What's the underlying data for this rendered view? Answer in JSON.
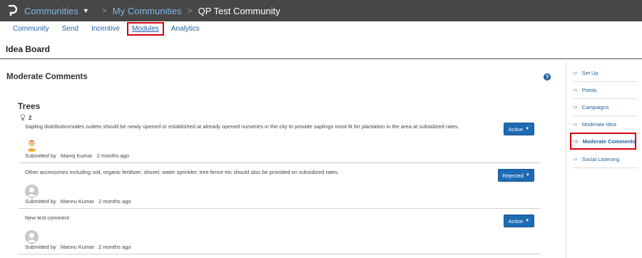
{
  "header": {
    "communities_label": "Communities",
    "my_communities_label": "My Communities",
    "current_community": "QP Test Community",
    "separator": ">"
  },
  "tabs": [
    {
      "label": "Community"
    },
    {
      "label": "Send"
    },
    {
      "label": "Incentive"
    },
    {
      "label": "Modules",
      "active": true
    },
    {
      "label": "Analytics"
    }
  ],
  "section_title": "Idea Board",
  "panel": {
    "title": "Moderate Comments",
    "help_glyph": "?"
  },
  "idea": {
    "title": "Trees",
    "comment_count": "2"
  },
  "comments": [
    {
      "text": "Sapling distribution/sales outlets should be newly opened or established at already opened nurseries in the city to provide saplings most-fit for plantation in the area at subsidized rates.",
      "submitted_by_label": "Submitted by",
      "author": "Manoj Kumar",
      "time": "2 months ago",
      "status": "Active",
      "avatar": "custom-avatar"
    },
    {
      "text": "Other accessories including soil, organic fertilizer, shovel, water sprinkler, tree fence etc should also be provided on subsidized rates.",
      "submitted_by_label": "Submitted by",
      "author": "Mannu Kumar",
      "time": "2 months ago",
      "status": "Rejected",
      "avatar": "default-avatar"
    },
    {
      "text": "New test comment",
      "submitted_by_label": "Submitted by",
      "author": "Mannu Kumar",
      "time": "2 months ago",
      "status": "Active",
      "avatar": "default-avatar"
    }
  ],
  "sidebar": {
    "items": [
      {
        "label": "Set Up",
        "icon": "sign-in-icon"
      },
      {
        "label": "Points",
        "icon": "sign-in-icon"
      },
      {
        "label": "Campaigns",
        "icon": "sign-in-icon"
      },
      {
        "label": "Moderate Idea",
        "icon": "sign-in-icon"
      },
      {
        "label": "Moderate Comments",
        "icon": "sign-in-icon",
        "active": true
      },
      {
        "label": "Social Listening",
        "icon": "sign-in-icon"
      }
    ]
  },
  "colors": {
    "topbar": "#474747",
    "link": "#1f5f9c",
    "button": "#1e6bb3",
    "highlight": "#d30010"
  }
}
